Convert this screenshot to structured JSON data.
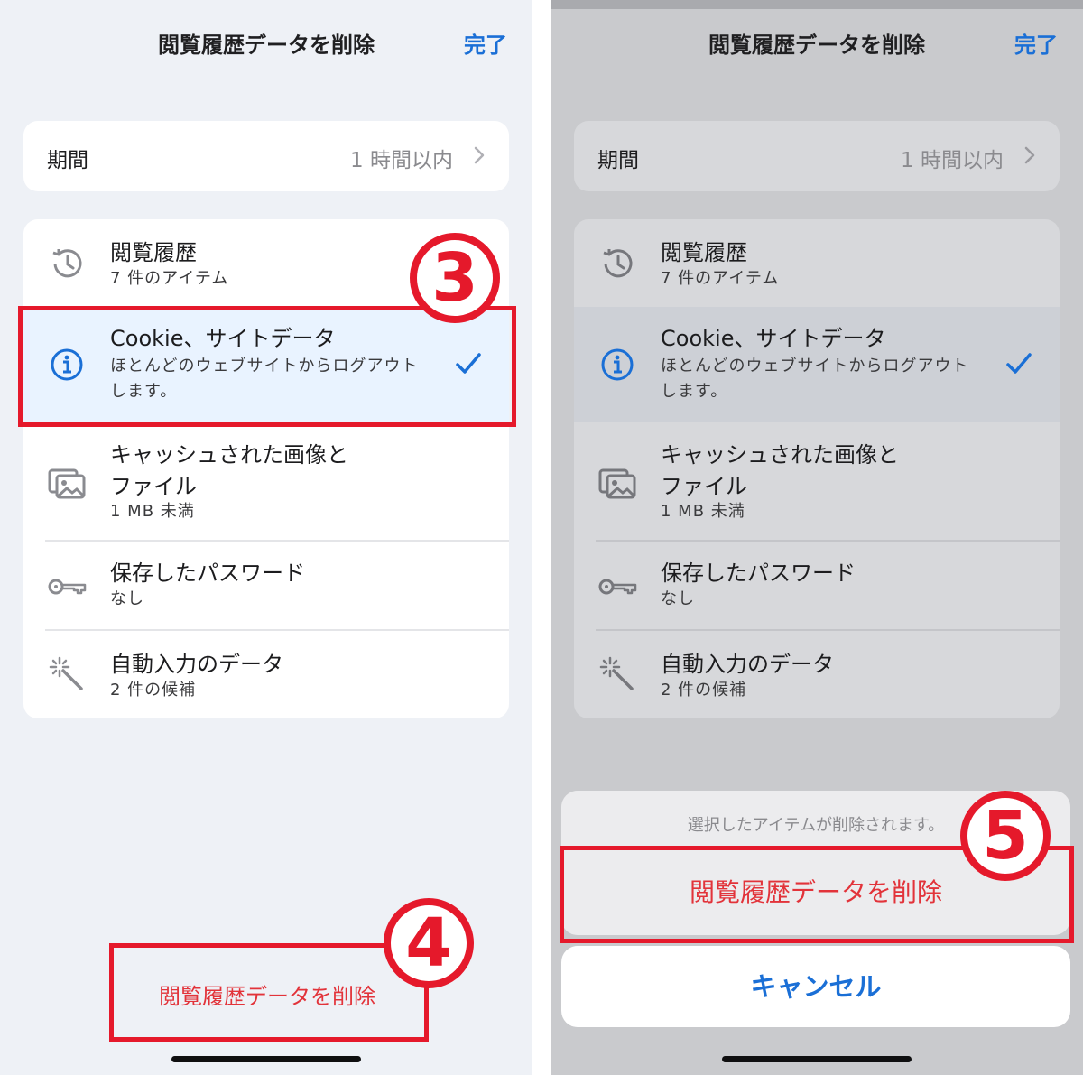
{
  "left": {
    "nav": {
      "title": "閲覧履歴データを削除",
      "done": "完了"
    },
    "period": {
      "label": "期間",
      "value": "1 時間以内"
    },
    "items": [
      {
        "title": "閲覧履歴",
        "subtitle": "7 件のアイテム",
        "icon": "history-icon"
      },
      {
        "title": "Cookie、サイトデータ",
        "subtitle_line1": "ほとんどのウェブサイトからログアウト",
        "subtitle_line2": "します。",
        "icon": "info-icon",
        "checked": true
      },
      {
        "title_line1": "キャッシュされた画像と",
        "title_line2": "ファイル",
        "subtitle": "1 MB 未満",
        "icon": "images-icon"
      },
      {
        "title": "保存したパスワード",
        "subtitle": "なし",
        "icon": "key-icon"
      },
      {
        "title": "自動入力のデータ",
        "subtitle": "2 件の候補",
        "icon": "magic-wand-icon"
      }
    ],
    "delete_link": "閲覧履歴データを削除",
    "badges": {
      "step3": "3",
      "step4": "4"
    }
  },
  "right": {
    "nav": {
      "title": "閲覧履歴データを削除",
      "done": "完了"
    },
    "period": {
      "label": "期間",
      "value": "1 時間以内"
    },
    "items": [
      {
        "title": "閲覧履歴",
        "subtitle": "7 件のアイテム"
      },
      {
        "title": "Cookie、サイトデータ",
        "subtitle_line1": "ほとんどのウェブサイトからログアウト",
        "subtitle_line2": "します。",
        "checked": true
      },
      {
        "title_line1": "キャッシュされた画像と",
        "title_line2": "ファイル",
        "subtitle": "1 MB 未満"
      },
      {
        "title": "保存したパスワード",
        "subtitle": "なし"
      },
      {
        "title": "自動入力のデータ",
        "subtitle": "2 件の候補"
      }
    ],
    "action_sheet": {
      "message": "選択したアイテムが削除されます。",
      "delete": "閲覧履歴データを削除",
      "cancel": "キャンセル"
    },
    "badges": {
      "step5": "5"
    }
  },
  "colors": {
    "accent": "#1a6fd6",
    "destructive": "#e2333a",
    "annotation": "#e5192b"
  }
}
